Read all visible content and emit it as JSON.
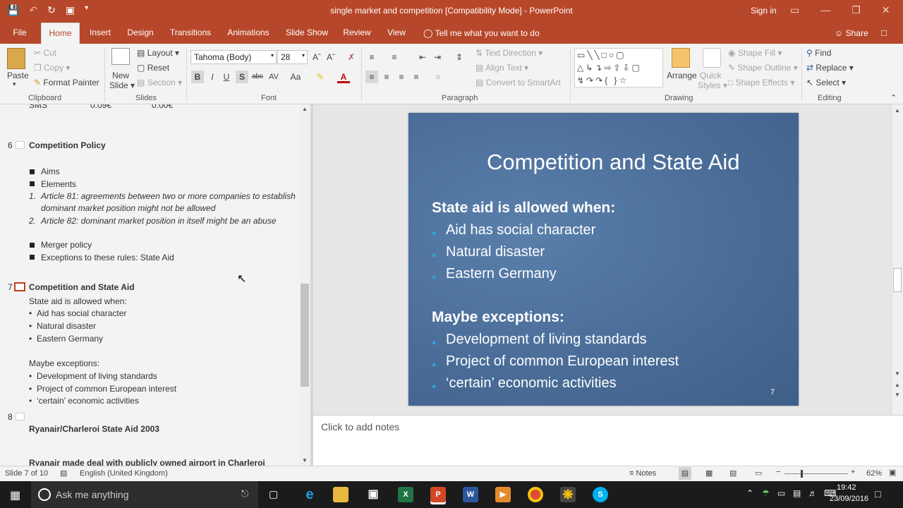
{
  "window": {
    "title": "single market and competition [Compatibility Mode] - PowerPoint",
    "sign_in": "Sign in"
  },
  "tabs": [
    "File",
    "Home",
    "Insert",
    "Design",
    "Transitions",
    "Animations",
    "Slide Show",
    "Review",
    "View"
  ],
  "tell_me": "Tell me what you want to do",
  "share": "Share",
  "ribbon": {
    "clipboard": {
      "paste": "Paste",
      "cut": "Cut",
      "copy": "Copy",
      "format_painter": "Format Painter",
      "group": "Clipboard"
    },
    "slides": {
      "new_slide_1": "New",
      "new_slide_2": "Slide",
      "layout": "Layout",
      "reset": "Reset",
      "section": "Section",
      "group": "Slides"
    },
    "font": {
      "family": "Tahoma (Body)",
      "size": "28",
      "bold": "B",
      "italic": "I",
      "underline": "U",
      "shadow": "S",
      "strike": "abc",
      "spacing": "AV",
      "case": "Aa",
      "group": "Font"
    },
    "paragraph": {
      "text_direction": "Text Direction",
      "align_text": "Align Text",
      "convert_smartart": "Convert to SmartArt",
      "group": "Paragraph"
    },
    "drawing": {
      "arrange": "Arrange",
      "quick_styles_1": "Quick",
      "quick_styles_2": "Styles",
      "shape_fill": "Shape Fill",
      "shape_outline": "Shape Outline",
      "shape_effects": "Shape Effects",
      "group": "Drawing"
    },
    "editing": {
      "find": "Find",
      "replace": "Replace",
      "select": "Select",
      "group": "Editing"
    }
  },
  "outline": {
    "top_partial": {
      "label": "SMS",
      "v1": "0.09€",
      "v2": "0.00€"
    },
    "slide6": {
      "number": "6",
      "title": "Competition Policy",
      "bullets": [
        "Aims",
        "Elements"
      ],
      "numbered": [
        {
          "n": "1.",
          "lines": [
            "Article 81: agreements between two or more companies to establish",
            "dominant market position might not be allowed"
          ]
        },
        {
          "n": "2.",
          "lines": [
            "Article 82: dominant market position in itself might be an abuse"
          ]
        }
      ],
      "bullets2": [
        "Merger policy",
        "Exceptions to these rules: State Aid"
      ]
    },
    "slide7": {
      "number": "7",
      "title": "Competition and State Aid",
      "intro": "State aid is allowed when:",
      "items": [
        "Aid has social character",
        "Natural disaster",
        "Eastern Germany"
      ],
      "intro2": "Maybe exceptions:",
      "items2": [
        "Development of living standards",
        "Project of common European interest",
        "‘certain’ economic activities"
      ]
    },
    "slide8": {
      "number": "8",
      "title": "Ryanair/Charleroi State Aid 2003",
      "partial": "Ryanair made deal with publicly owned airport in Charleroi"
    }
  },
  "slide": {
    "title": "Competition and State Aid",
    "h1": "State aid is allowed when:",
    "list1": [
      "Aid has social character",
      "Natural disaster",
      "Eastern Germany"
    ],
    "h2": "Maybe exceptions:",
    "list2": [
      "Development of living standards",
      "Project of common European interest",
      "‘certain’ economic activities"
    ],
    "page_number": "7",
    "background_color": "#4c6f9a",
    "bullet_color": "#2ea6d8"
  },
  "notes_placeholder": "Click to add notes",
  "status": {
    "slide_info": "Slide 7 of 10",
    "language": "English (United Kingdom)",
    "notes": "Notes",
    "zoom": "62%"
  },
  "taskbar": {
    "search": "Ask me anything",
    "time": "19:42",
    "date": "23/09/2016"
  },
  "colors": {
    "accent": "#b7472a"
  }
}
